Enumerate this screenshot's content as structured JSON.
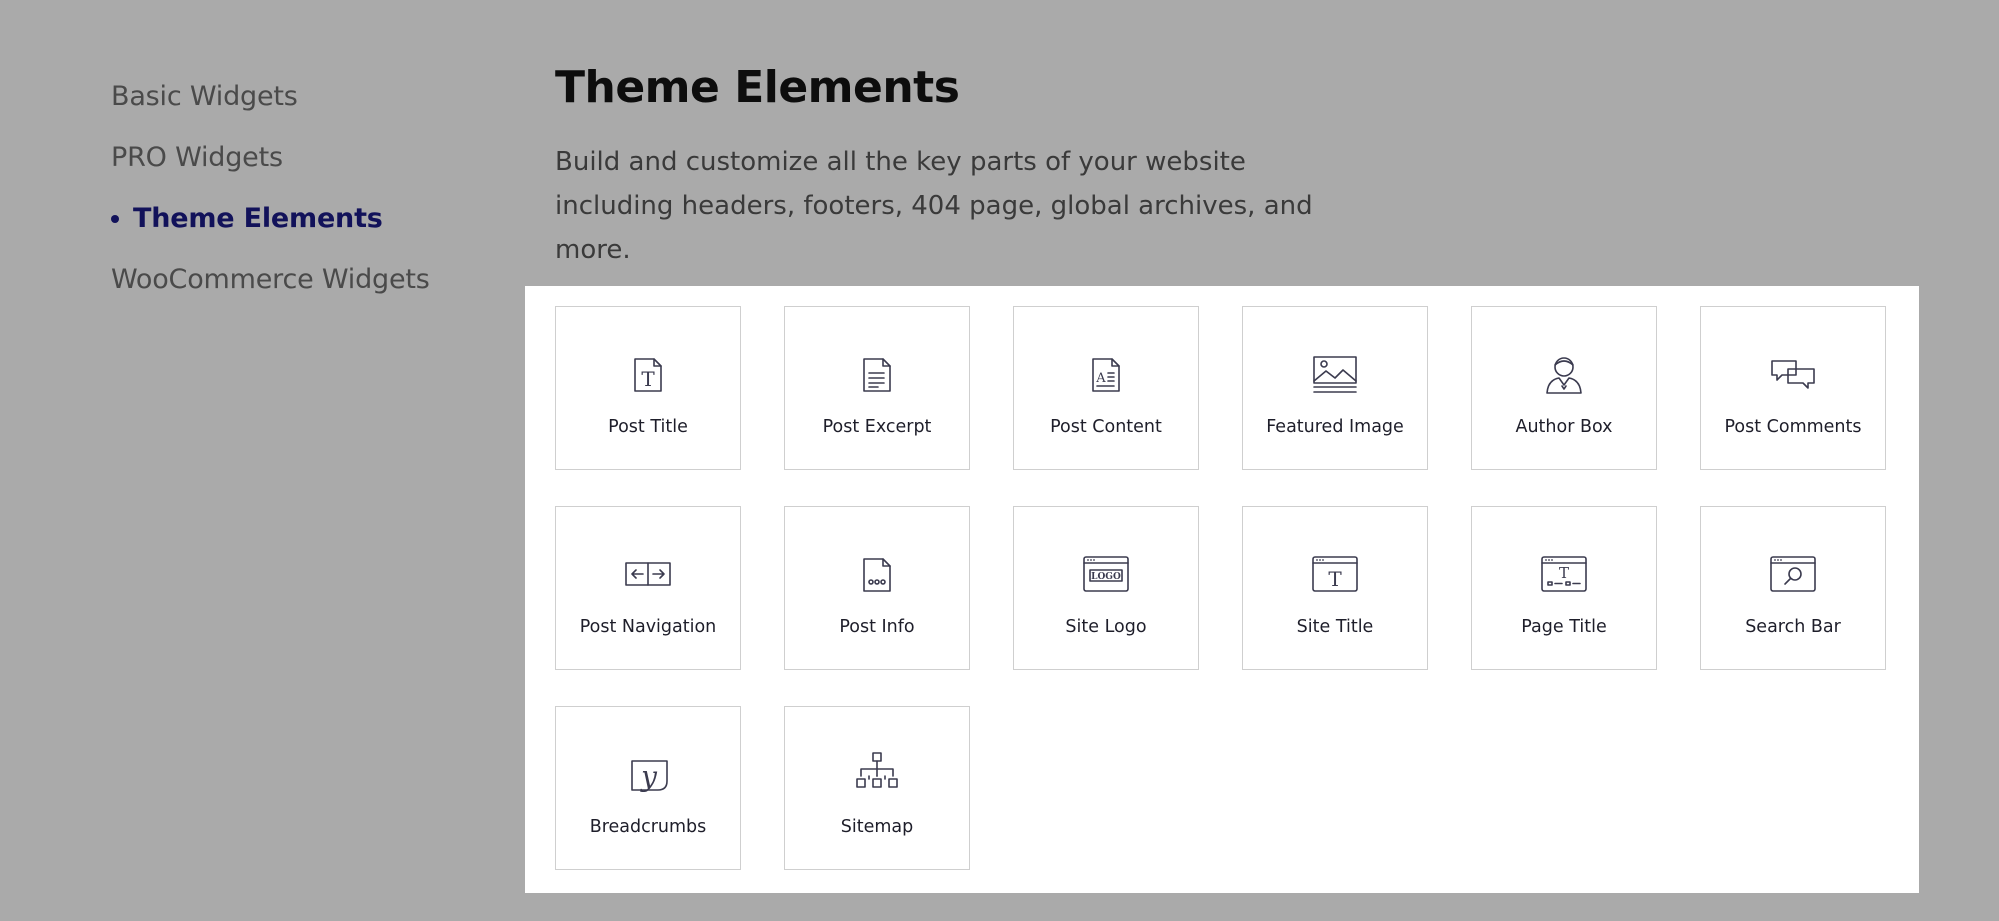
{
  "sidebar": {
    "items": [
      {
        "label": "Basic Widgets",
        "active": false
      },
      {
        "label": "PRO Widgets",
        "active": false
      },
      {
        "label": "Theme Elements",
        "active": true
      },
      {
        "label": "WooCommerce Widgets",
        "active": false
      }
    ]
  },
  "main": {
    "title": "Theme Elements",
    "description": "Build and customize all the key parts of your website including headers, footers, 404 page, global archives, and more."
  },
  "widgets": [
    {
      "label": "Post Title",
      "icon": "post-title-icon"
    },
    {
      "label": "Post Excerpt",
      "icon": "post-excerpt-icon"
    },
    {
      "label": "Post Content",
      "icon": "post-content-icon"
    },
    {
      "label": "Featured Image",
      "icon": "featured-image-icon"
    },
    {
      "label": "Author Box",
      "icon": "author-box-icon"
    },
    {
      "label": "Post Comments",
      "icon": "post-comments-icon"
    },
    {
      "label": "Post Navigation",
      "icon": "post-navigation-icon"
    },
    {
      "label": "Post Info",
      "icon": "post-info-icon"
    },
    {
      "label": "Site Logo",
      "icon": "site-logo-icon"
    },
    {
      "label": "Site Title",
      "icon": "site-title-icon"
    },
    {
      "label": "Page Title",
      "icon": "page-title-icon"
    },
    {
      "label": "Search Bar",
      "icon": "search-bar-icon"
    },
    {
      "label": "Breadcrumbs",
      "icon": "breadcrumbs-icon"
    },
    {
      "label": "Sitemap",
      "icon": "sitemap-icon"
    }
  ],
  "icon_text": {
    "post_title": "T",
    "post_content": "A",
    "site_logo": "LOGO",
    "site_title": "T",
    "page_title": "T",
    "breadcrumbs": "y"
  },
  "colors": {
    "background": "#aaaaaa",
    "panel": "#ffffff",
    "accent": "#12125a",
    "icon_stroke": "#3b3b4f"
  }
}
